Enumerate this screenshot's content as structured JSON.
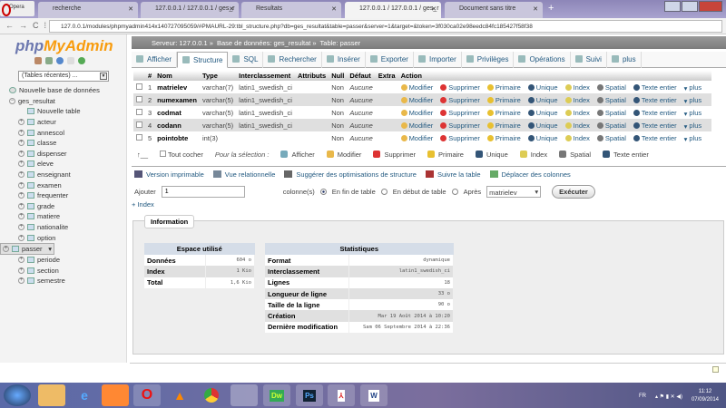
{
  "browser": {
    "opera_label": "Opera",
    "tabs": [
      "recherche",
      "127.0.0.1 / 127.0.0.1 / ges_r",
      "Resultats",
      "127.0.0.1 / 127.0.0.1 / ges_r",
      "Document sans titre"
    ],
    "url": "127.0.0.1/modules/phpmyadmin414x140727095059/#PMAURL-29:tbl_structure.php?db=ges_resultat&table=passer&server=1&target=&token=3f030ca02e98eedc84fc185427f58f38"
  },
  "sidebar": {
    "logo_php": "php",
    "logo_myadmin": "MyAdmin",
    "recent": "(Tables récentes) ...",
    "new_db": "Nouvelle base de données",
    "db": "ges_resultat",
    "new_table": "Nouvelle table",
    "tables": [
      "acteur",
      "annescol",
      "classe",
      "dispenser",
      "eleve",
      "enseignant",
      "examen",
      "frequenter",
      "grade",
      "matiere",
      "nationalite",
      "option",
      "passer",
      "periode",
      "section",
      "semestre"
    ],
    "selected": "passer"
  },
  "breadcrumb": {
    "server": "Serveur: 127.0.0.1",
    "database": "Base de données: ges_resultat",
    "table": "Table: passer"
  },
  "tabs": [
    "Afficher",
    "Structure",
    "SQL",
    "Rechercher",
    "Insérer",
    "Exporter",
    "Importer",
    "Privilèges",
    "Opérations",
    "Suivi",
    "plus"
  ],
  "active_tab": "Structure",
  "structure": {
    "headers": [
      "#",
      "Nom",
      "Type",
      "Interclassement",
      "Attributs",
      "Null",
      "Défaut",
      "Extra",
      "Action"
    ],
    "rows": [
      {
        "num": "1",
        "name": "matrielev",
        "type": "varchar(7)",
        "collation": "latin1_swedish_ci",
        "attr": "",
        "null": "Non",
        "default": "Aucune",
        "extra": ""
      },
      {
        "num": "2",
        "name": "numexamen",
        "type": "varchar(5)",
        "collation": "latin1_swedish_ci",
        "attr": "",
        "null": "Non",
        "default": "Aucune",
        "extra": ""
      },
      {
        "num": "3",
        "name": "codmat",
        "type": "varchar(5)",
        "collation": "latin1_swedish_ci",
        "attr": "",
        "null": "Non",
        "default": "Aucune",
        "extra": ""
      },
      {
        "num": "4",
        "name": "codann",
        "type": "varchar(5)",
        "collation": "latin1_swedish_ci",
        "attr": "",
        "null": "Non",
        "default": "Aucune",
        "extra": ""
      },
      {
        "num": "5",
        "name": "pointobte",
        "type": "int(3)",
        "collation": "",
        "attr": "",
        "null": "Non",
        "default": "Aucune",
        "extra": ""
      }
    ],
    "actions": [
      "Modifier",
      "Supprimer",
      "Primaire",
      "Unique",
      "Index",
      "Spatial",
      "Texte entier",
      "plus"
    ]
  },
  "selection": {
    "check_all": "Tout cocher",
    "for_selection": "Pour la sélection :",
    "actions": [
      "Afficher",
      "Modifier",
      "Supprimer",
      "Primaire",
      "Unique",
      "Index",
      "Spatial",
      "Texte entier"
    ]
  },
  "links": [
    "Version imprimable",
    "Vue relationnelle",
    "Suggérer des optimisations de structure",
    "Suivre la table",
    "Déplacer des colonnes"
  ],
  "add": {
    "label": "Ajouter",
    "value": "1",
    "columns": "colonne(s)",
    "end": "En fin de table",
    "start": "En début de table",
    "after": "Après",
    "after_col": "matrielev",
    "execute": "Exécuter",
    "plus_index": "+ Index"
  },
  "info": {
    "legend": "Information",
    "space": {
      "title": "Espace utilisé",
      "rows": [
        [
          "Données",
          "604 o"
        ],
        [
          "Index",
          "1 Kio"
        ],
        [
          "Total",
          "1,6 Kio"
        ]
      ]
    },
    "stats": {
      "title": "Statistiques",
      "rows": [
        [
          "Format",
          "dynamique"
        ],
        [
          "Interclassement",
          "latin1_swedish_ci"
        ],
        [
          "Lignes",
          "18"
        ],
        [
          "Longueur de ligne",
          "33 o"
        ],
        [
          "Taille de la ligne",
          "90 o"
        ],
        [
          "Création",
          "Mar 19 Août 2014 à 10:20"
        ],
        [
          "Dernière modification",
          "Sam 06 Septembre 2014 à 22:36"
        ]
      ]
    }
  },
  "taskbar": {
    "lang": "FR",
    "time": "11:12",
    "date": "07/09/2014",
    "apps": [
      "Dw",
      "Ps"
    ]
  }
}
